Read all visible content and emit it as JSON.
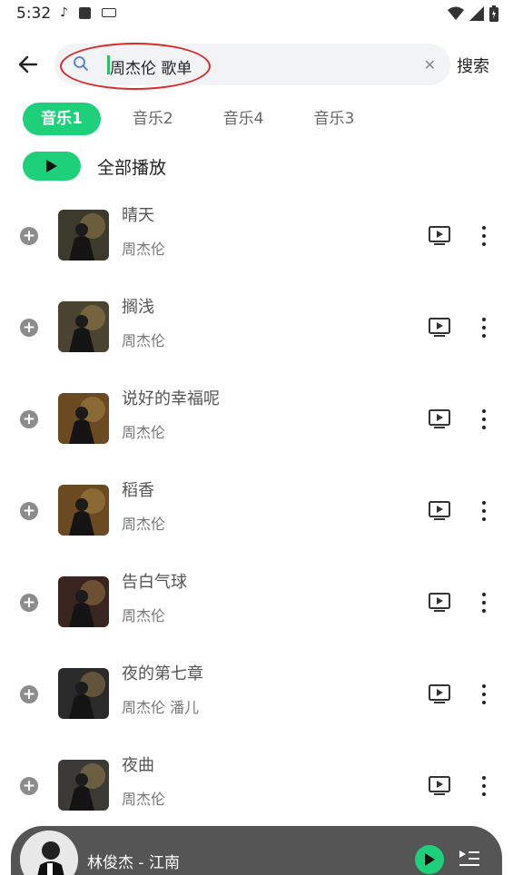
{
  "status_bar": {
    "time": "5:32"
  },
  "header": {
    "search_value": "周杰伦 歌单",
    "search_button": "搜索"
  },
  "tabs": [
    {
      "label": "音乐1",
      "active": true
    },
    {
      "label": "音乐2",
      "active": false
    },
    {
      "label": "音乐4",
      "active": false
    },
    {
      "label": "音乐3",
      "active": false
    }
  ],
  "play_all": {
    "label": "全部播放"
  },
  "songs": [
    {
      "title": "晴天",
      "artist": "周杰伦",
      "cover_color": "#3b3a2c"
    },
    {
      "title": "搁浅",
      "artist": "周杰伦",
      "cover_color": "#4a4330"
    },
    {
      "title": "说好的幸福呢",
      "artist": "周杰伦",
      "cover_color": "#6b4a22"
    },
    {
      "title": "稻香",
      "artist": "周杰伦",
      "cover_color": "#6b4a22"
    },
    {
      "title": "告白气球",
      "artist": "周杰伦",
      "cover_color": "#3a2420"
    },
    {
      "title": "夜的第七章",
      "artist": "周杰伦 潘儿",
      "cover_color": "#2a2a2a"
    },
    {
      "title": "夜曲",
      "artist": "周杰伦",
      "cover_color": "#3c3a36"
    }
  ],
  "mini_player": {
    "now_playing": "林俊杰 - 江南"
  },
  "colors": {
    "accent": "#1ed07a",
    "highlight_circle": "#d92b2b",
    "player_bg": "#555555"
  }
}
